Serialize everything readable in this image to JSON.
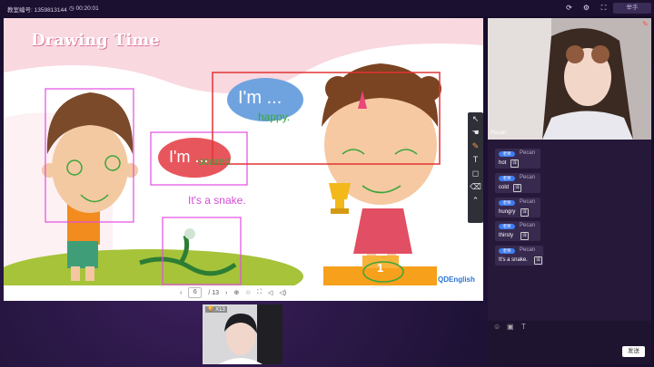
{
  "topbar": {
    "room_label": "教室编号: 1359813144",
    "timer": "00:20:01",
    "raise_hand": "举手"
  },
  "slide": {
    "title": "Drawing Time",
    "bubble_blue": "I'm ...",
    "bubble_red": "I'm ...",
    "written_happy": "happy.",
    "written_scared": "scared",
    "written_snake": "It's a snake.",
    "brand": "QDEnglish",
    "podium_number": "1"
  },
  "pager": {
    "current": "6",
    "total": "/ 13"
  },
  "tools": [
    "cursor-icon",
    "hand-icon",
    "pen-icon",
    "text-icon",
    "shape-icon",
    "eraser-icon",
    "collapse-icon"
  ],
  "teacher_video": {
    "name": "Pecan"
  },
  "chat": {
    "messages": [
      {
        "tag": "老师",
        "name": "Pecan",
        "text": "hot"
      },
      {
        "tag": "老师",
        "name": "Pecan",
        "text": "cold"
      },
      {
        "tag": "老师",
        "name": "Pecan",
        "text": "hungry"
      },
      {
        "tag": "老师",
        "name": "Pecan",
        "text": "thirsty"
      },
      {
        "tag": "老师",
        "name": "Pecan",
        "text": "It's a snake."
      }
    ],
    "send_label": "发送"
  },
  "student": {
    "badge": "X13"
  }
}
